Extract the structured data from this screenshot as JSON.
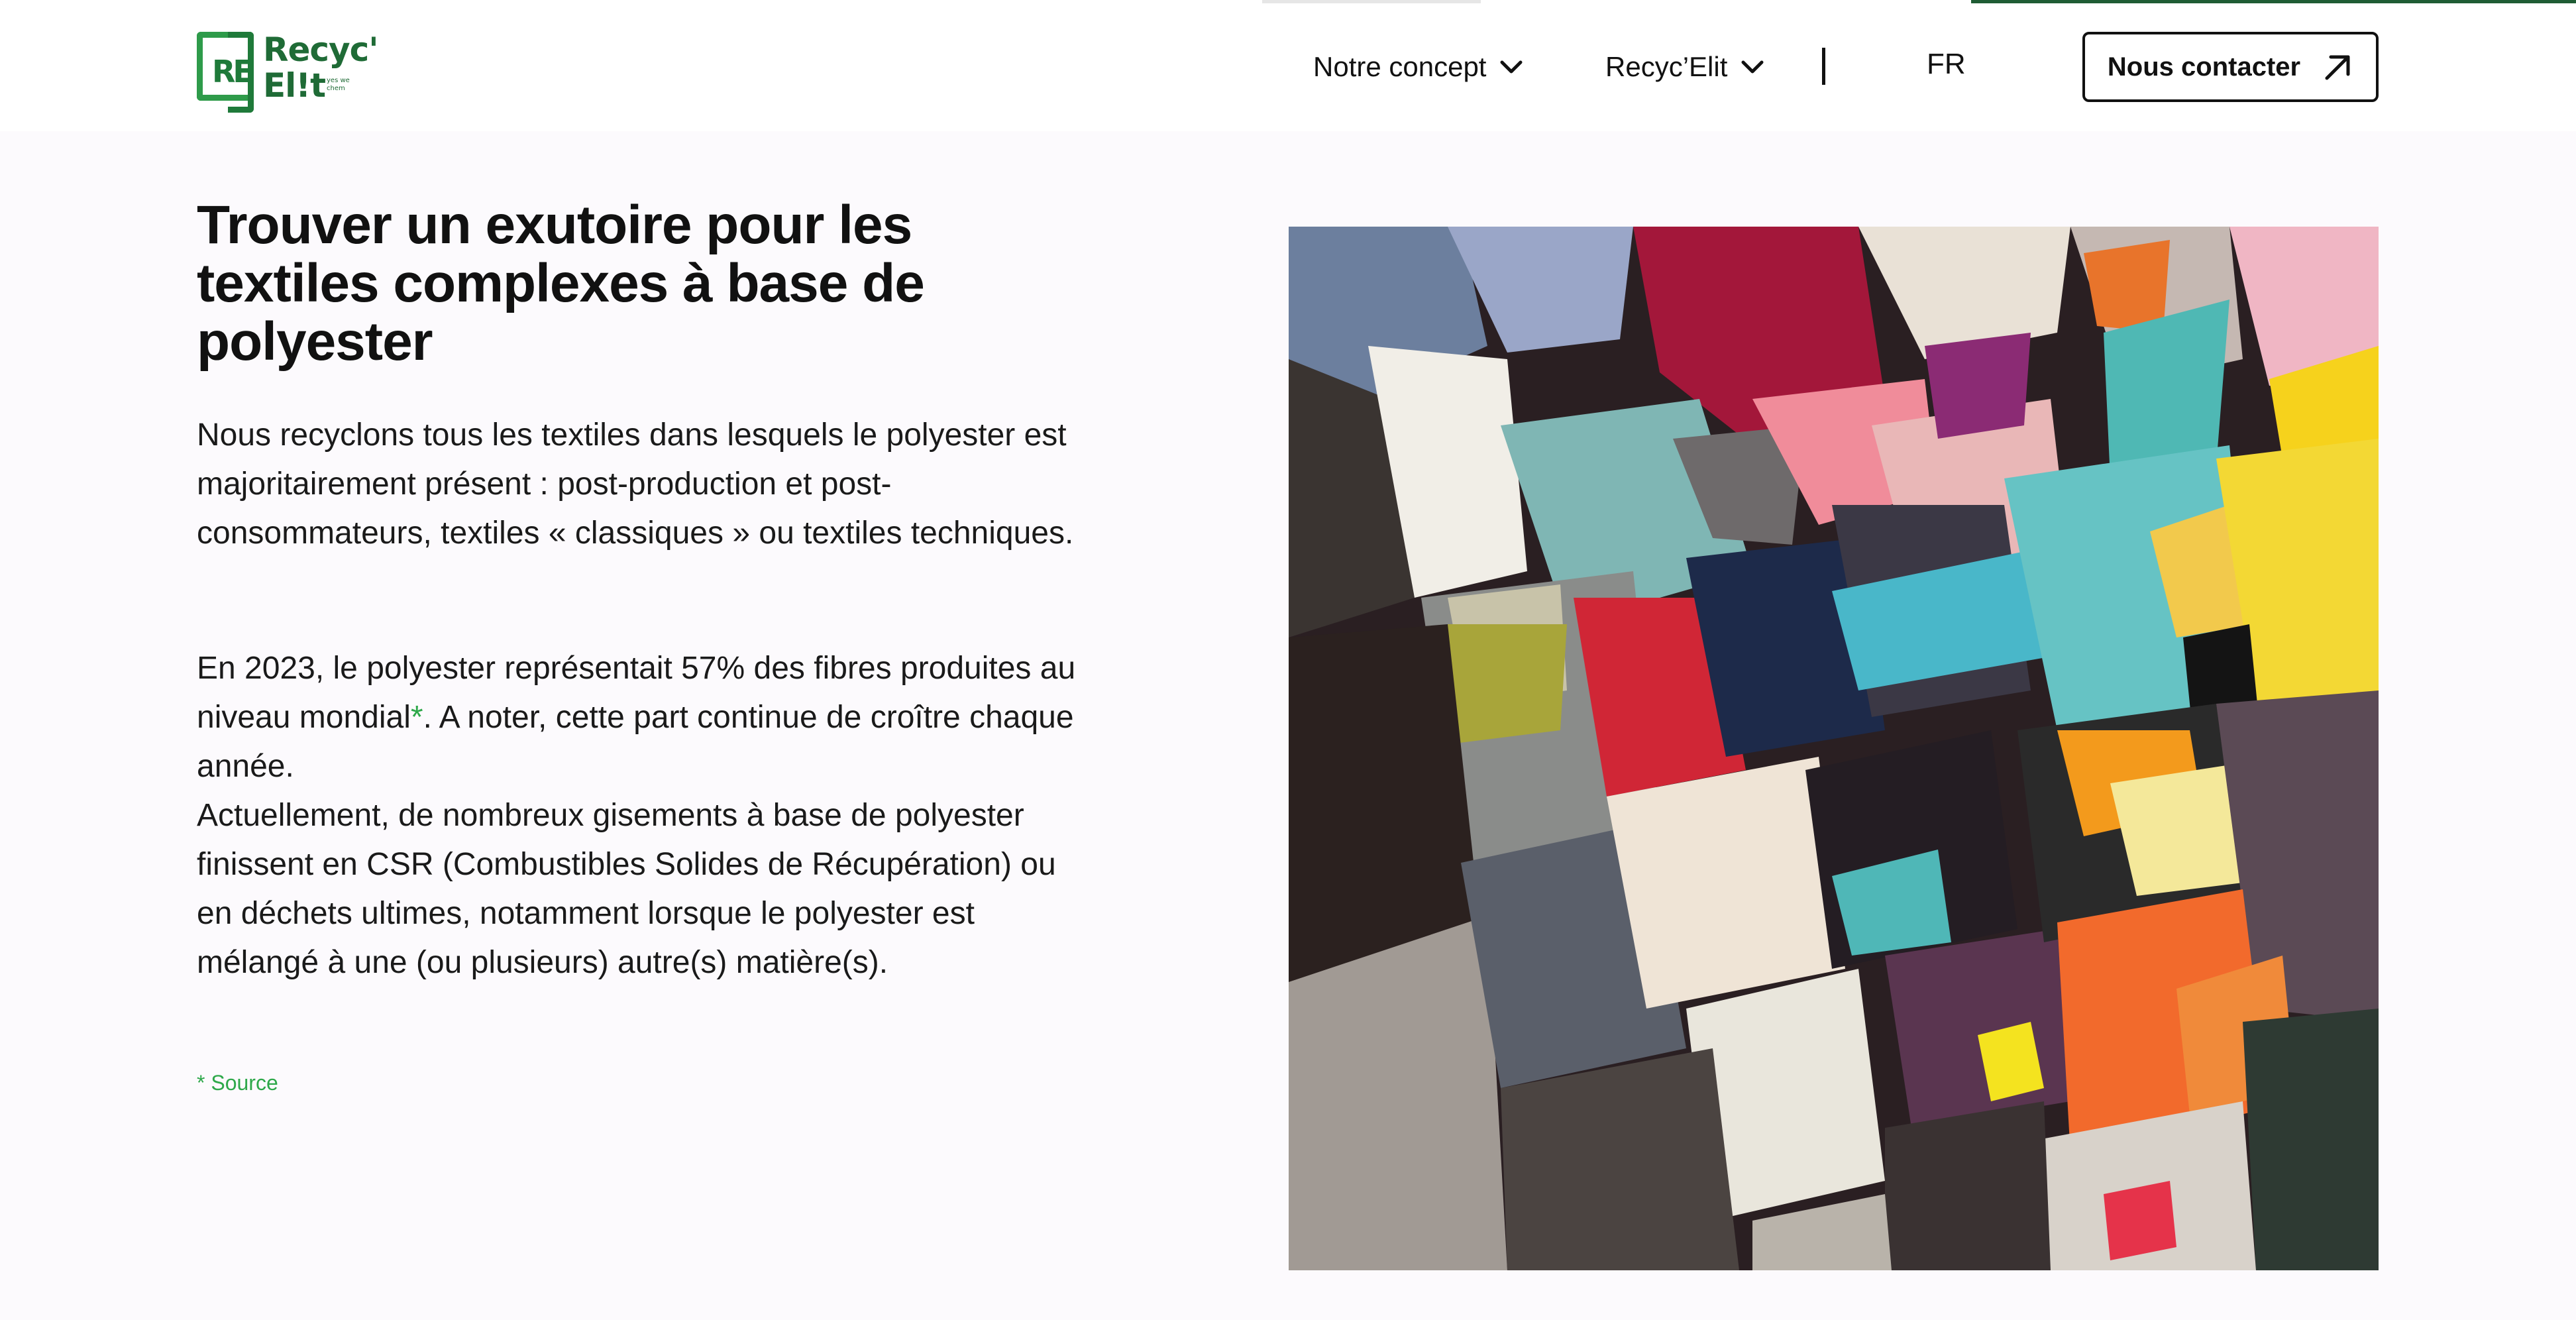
{
  "header": {
    "logo": {
      "mark": "RE",
      "line1": "Recyc'",
      "line2": "El!t",
      "tagline": "yes we chem"
    },
    "nav": {
      "concept_label": "Notre concept",
      "recyc_label": "Recyc’Elit",
      "language": "FR",
      "contact_label": "Nous contacter"
    }
  },
  "main": {
    "title": "Trouver un exutoire pour les textiles complexes à base de polyester",
    "paragraph1": "Nous recyclons tous les textiles dans lesquels le polyester est majoritairement présent : post-production et post-consommateurs, textiles « classiques » ou textiles techniques.",
    "paragraph2_before": "En 2023, le polyester représentait 57% des fibres produites au niveau mondial",
    "paragraph2_asterisk": "*",
    "paragraph2_after": ". A noter, cette part continue de croître chaque année.",
    "paragraph2_line2": "Actuellement, de nombreux gisements à base de polyester finissent en CSR (Combustibles Solides de Récupération) ou en déchets ultimes, notamment lorsque le polyester est mélangé à une (ou plusieurs) autre(s) matière(s).",
    "source_label": "* Source"
  },
  "colors": {
    "brand_green": "#1f7a3a",
    "accent_green": "#2ea84a",
    "text": "#111111",
    "background": "#fcfafd"
  },
  "icons": {
    "nav_chevron": "chevron-down-icon",
    "contact_arrow": "arrow-up-right-icon"
  }
}
